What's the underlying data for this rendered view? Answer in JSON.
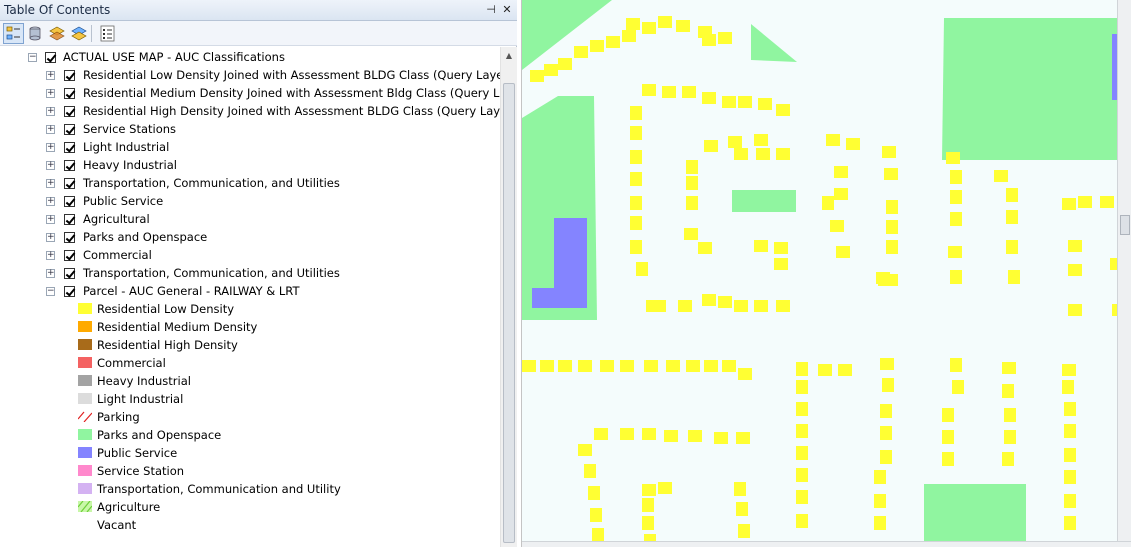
{
  "toc": {
    "title": "Table Of Contents",
    "pin_label": "⊣",
    "close_label": "✕",
    "group": {
      "label": "ACTUAL USE MAP - AUC Classifications",
      "layers": [
        {
          "label": "Residential Low Density Joined with Assessment BLDG Class (Query Layer)"
        },
        {
          "label": "Residential Medium Density Joined with Assessment Bldg Class (Query Layer)"
        },
        {
          "label": "Residential High Density Joined with Assessment BLDG Class (Query Layer)"
        },
        {
          "label": "Service Stations"
        },
        {
          "label": "Light Industrial"
        },
        {
          "label": "Heavy Industrial"
        },
        {
          "label": "Transportation, Communication, and Utilities"
        },
        {
          "label": "Public Service"
        },
        {
          "label": "Agricultural"
        },
        {
          "label": "Parks and Openspace"
        },
        {
          "label": "Commercial"
        },
        {
          "label": "Transportation, Communication, and Utilities"
        },
        {
          "label": "Parcel - AUC General - RAILWAY & LRT"
        }
      ]
    },
    "legend": [
      {
        "label": "Residential Low Density",
        "color": "#ffff33",
        "style": "fill"
      },
      {
        "label": "Residential Medium Density",
        "color": "#ffaa00",
        "style": "fill"
      },
      {
        "label": "Residential High Density",
        "color": "#a86b1a",
        "style": "fill"
      },
      {
        "label": "Commercial",
        "color": "#f46262",
        "style": "fill"
      },
      {
        "label": "Heavy Industrial",
        "color": "#a3a3a3",
        "style": "fill"
      },
      {
        "label": "Light Industrial",
        "color": "#dcdcdc",
        "style": "fill"
      },
      {
        "label": "Parking",
        "color": "#e02020",
        "style": "hatch"
      },
      {
        "label": "Parks and Openspace",
        "color": "#90f5a0",
        "style": "fill"
      },
      {
        "label": "Public Service",
        "color": "#8484ff",
        "style": "fill"
      },
      {
        "label": "Service Station",
        "color": "#ff88cc",
        "style": "fill"
      },
      {
        "label": "Transportation, Communication and Utility",
        "color": "#d4b2f2",
        "style": "fill"
      },
      {
        "label": "Agriculture",
        "color": "#a8f070",
        "style": "hatch-green"
      },
      {
        "label": "Vacant",
        "color": "#ffffff",
        "style": "none"
      }
    ]
  },
  "colors": {
    "road": "#f4fcfc",
    "park": "#90f5a0",
    "public_service": "#8484ff",
    "residential_low": "#ffff33"
  }
}
